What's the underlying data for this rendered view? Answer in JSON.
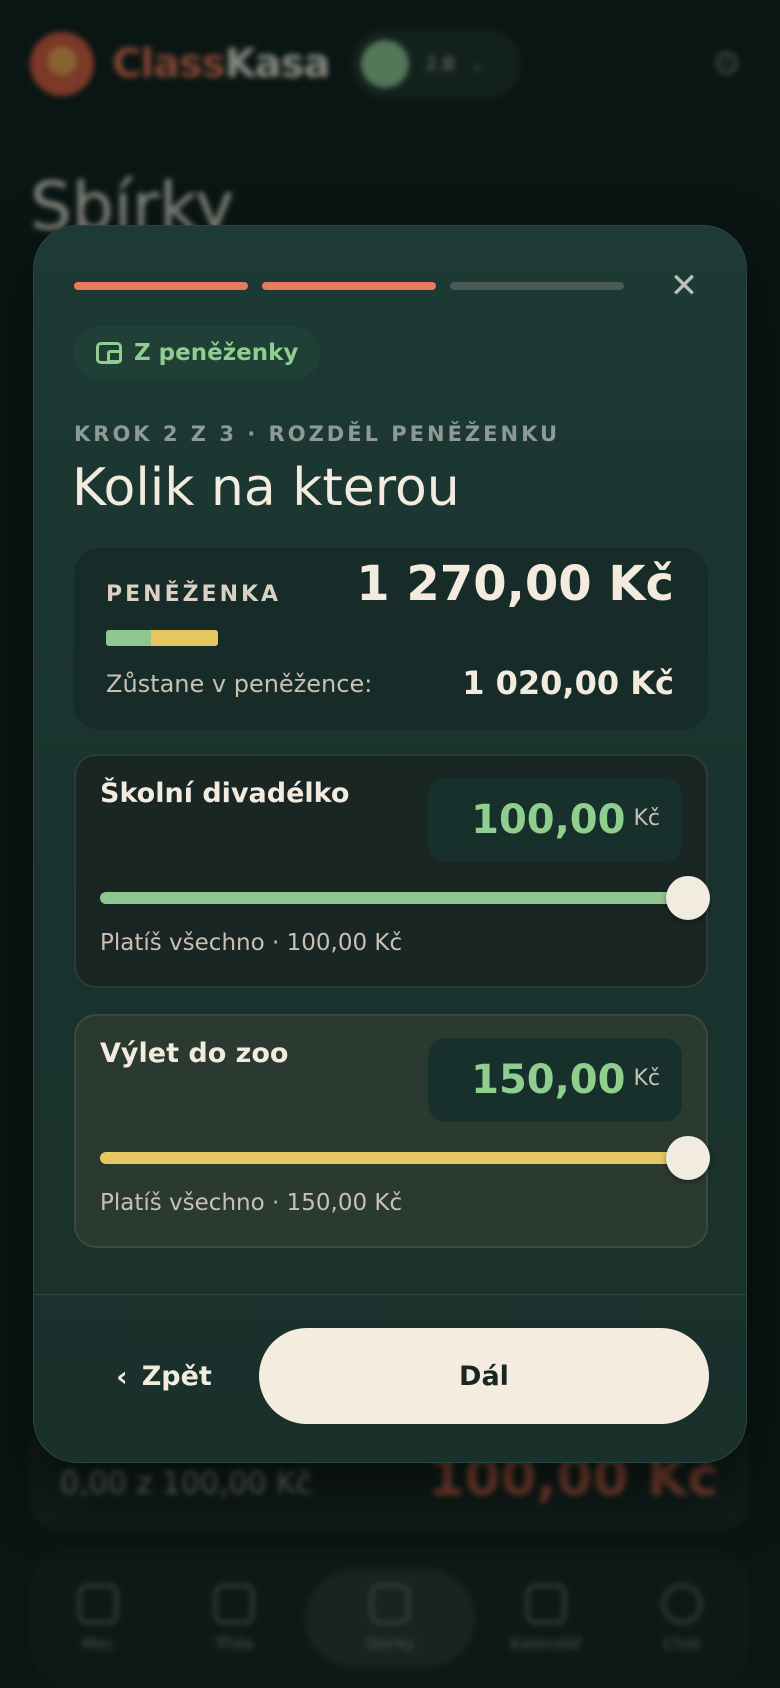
{
  "background": {
    "brand_part1": "Class",
    "brand_part2": "Kasa",
    "user_label": "2.B",
    "page_title": "Sbírky",
    "card_left_text": "0,00 z 100,00 Kč",
    "card_right_text": "100,00 Kč",
    "nav": [
      {
        "label": "Moc"
      },
      {
        "label": "Třída"
      },
      {
        "label": "Sbírky"
      },
      {
        "label": "Kalendář"
      },
      {
        "label": "Chat"
      }
    ]
  },
  "modal": {
    "progress": {
      "current_step": 2,
      "total_steps": 3
    },
    "close_glyph": "✕",
    "source_chip": "Z peněženky",
    "step_label": "KROK 2 Z 3 · ROZDĚL PENĚŽENKU",
    "title": "Kolik na kterou",
    "wallet": {
      "label": "PENĚŽENKA",
      "total": "1 270,00 Kč",
      "remaining_label": "Zůstane v peněžence:",
      "remaining_value": "1 020,00 Kč",
      "colors": {
        "item1": "#8fc78f",
        "item2": "#e7c761"
      }
    },
    "items": [
      {
        "name": "Školní divadélko",
        "amount": "100,00",
        "currency": "Kč",
        "slider_fraction": 1.0,
        "note": "Platíš všechno · 100,00 Kč",
        "color": "#8fc78f"
      },
      {
        "name": "Výlet do zoo",
        "amount": "150,00",
        "currency": "Kč",
        "slider_fraction": 1.0,
        "note": "Platíš všechno · 150,00 Kč",
        "color": "#e7c761"
      }
    ],
    "back_label": "Zpět",
    "back_glyph": "‹",
    "next_label": "Dál"
  },
  "accent_color": "#e97a5f"
}
